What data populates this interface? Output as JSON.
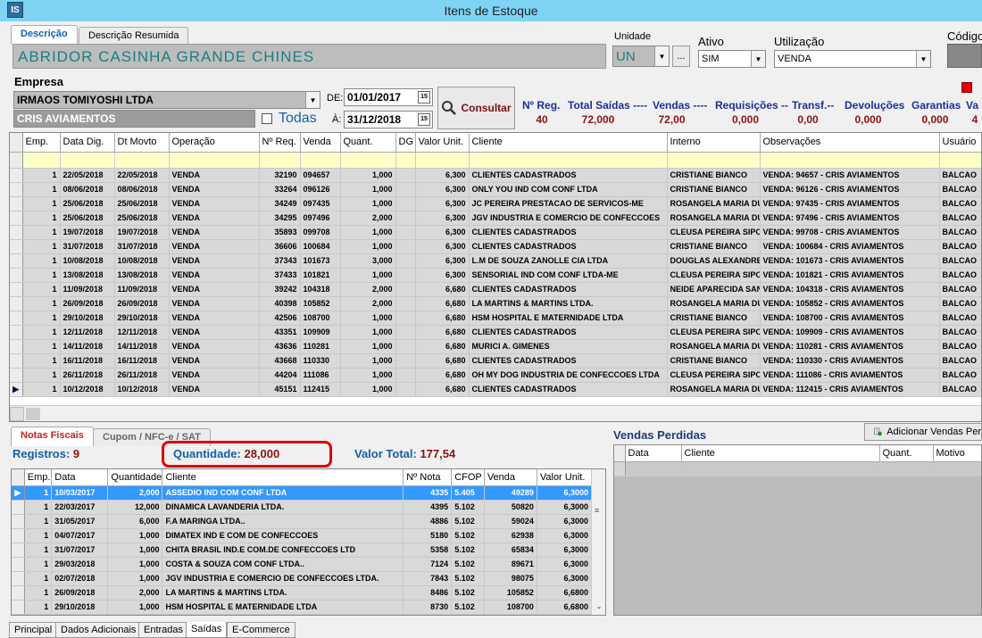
{
  "window": {
    "title": "Itens de Estoque",
    "icon_text": "IS"
  },
  "desc_tabs": [
    "Descrição",
    "Descrição Resumida"
  ],
  "description": "ABRIDOR CASINHA GRANDE CHINES",
  "unidade": {
    "label": "Unidade",
    "value": "UN",
    "btn": "..."
  },
  "ativo": {
    "label": "Ativo",
    "value": "SIM"
  },
  "utilizacao": {
    "label": "Utilização",
    "value": "VENDA"
  },
  "codigo": {
    "label": "Código"
  },
  "empresa": {
    "label": "Empresa",
    "value": "IRMAOS TOMIYOSHI LTDA",
    "client": "CRIS AVIAMENTOS",
    "todas": "Todas"
  },
  "dates": {
    "de_label": "DE:",
    "de": "01/01/2017",
    "a_label": "À:",
    "a": "31/12/2018",
    "cal": "15"
  },
  "consultar": "Consultar",
  "stats": {
    "headers": [
      "Nº Reg.",
      "Total Saídas ----",
      "Vendas ----",
      "Requisições --",
      "Transf.--",
      "Devoluções",
      "Garantias",
      "Va"
    ],
    "values": [
      "40",
      "72,000",
      "72,00",
      "0,000",
      "0,00",
      "0,000",
      "0,000",
      "4"
    ]
  },
  "main_grid": {
    "columns": [
      "Emp.",
      "Data Dig.",
      "Dt Movto",
      "Operação",
      "Nº Req.",
      "Venda",
      "Quant.",
      "DG",
      "Valor Unit.",
      "Cliente",
      "Interno",
      "Observações",
      "Usuário"
    ],
    "rows": [
      [
        "1",
        "22/05/2018",
        "22/05/2018",
        "VENDA",
        "32190",
        "094657",
        "1,000",
        "",
        "6,300",
        "CLIENTES CADASTRADOS",
        "CRISTIANE BIANCO",
        "VENDA: 94657 - CRIS AVIAMENTOS",
        "BALCAO"
      ],
      [
        "1",
        "08/06/2018",
        "08/06/2018",
        "VENDA",
        "33264",
        "096126",
        "1,000",
        "",
        "6,300",
        "ONLY YOU IND COM CONF LTDA",
        "CRISTIANE BIANCO",
        "VENDA: 96126 - CRIS AVIAMENTOS",
        "BALCAO"
      ],
      [
        "1",
        "25/06/2018",
        "25/06/2018",
        "VENDA",
        "34249",
        "097435",
        "1,000",
        "",
        "6,300",
        "JC PEREIRA PRESTACAO DE SERVICOS-ME",
        "ROSANGELA MARIA DU",
        "VENDA: 97435 - CRIS AVIAMENTOS",
        "BALCAO"
      ],
      [
        "1",
        "25/06/2018",
        "25/06/2018",
        "VENDA",
        "34295",
        "097496",
        "2,000",
        "",
        "6,300",
        "JGV INDUSTRIA E COMERCIO DE CONFECCOES",
        "ROSANGELA MARIA DU",
        "VENDA: 97496 - CRIS AVIAMENTOS",
        "BALCAO"
      ],
      [
        "1",
        "19/07/2018",
        "19/07/2018",
        "VENDA",
        "35893",
        "099708",
        "1,000",
        "",
        "6,300",
        "CLIENTES CADASTRADOS",
        "CLEUSA PEREIRA SIPO",
        "VENDA: 99708 - CRIS AVIAMENTOS",
        "BALCAO"
      ],
      [
        "1",
        "31/07/2018",
        "31/07/2018",
        "VENDA",
        "36606",
        "100684",
        "1,000",
        "",
        "6,300",
        "CLIENTES CADASTRADOS",
        "CRISTIANE BIANCO",
        "VENDA: 100684 - CRIS AVIAMENTOS",
        "BALCAO"
      ],
      [
        "1",
        "10/08/2018",
        "10/08/2018",
        "VENDA",
        "37343",
        "101673",
        "3,000",
        "",
        "6,300",
        "L.M DE SOUZA ZANOLLE CIA LTDA",
        "DOUGLAS ALEXANDRE",
        "VENDA: 101673 - CRIS AVIAMENTOS",
        "BALCAO"
      ],
      [
        "1",
        "13/08/2018",
        "13/08/2018",
        "VENDA",
        "37433",
        "101821",
        "1,000",
        "",
        "6,300",
        "SENSORIAL IND COM CONF LTDA-ME",
        "CLEUSA PEREIRA SIPO",
        "VENDA: 101821 - CRIS AVIAMENTOS",
        "BALCAO"
      ],
      [
        "1",
        "11/09/2018",
        "11/09/2018",
        "VENDA",
        "39242",
        "104318",
        "2,000",
        "",
        "6,680",
        "CLIENTES CADASTRADOS",
        "NEIDE APARECIDA SAN",
        "VENDA: 104318 - CRIS AVIAMENTOS",
        "BALCAO"
      ],
      [
        "1",
        "26/09/2018",
        "26/09/2018",
        "VENDA",
        "40398",
        "105852",
        "2,000",
        "",
        "6,680",
        "LA MARTINS & MARTINS LTDA.",
        "ROSANGELA MARIA DU",
        "VENDA: 105852 - CRIS AVIAMENTOS",
        "BALCAO"
      ],
      [
        "1",
        "29/10/2018",
        "29/10/2018",
        "VENDA",
        "42506",
        "108700",
        "1,000",
        "",
        "6,680",
        "HSM HOSPITAL E MATERNIDADE LTDA",
        "CRISTIANE BIANCO",
        "VENDA: 108700 - CRIS AVIAMENTOS",
        "BALCAO"
      ],
      [
        "1",
        "12/11/2018",
        "12/11/2018",
        "VENDA",
        "43351",
        "109909",
        "1,000",
        "",
        "6,680",
        "CLIENTES CADASTRADOS",
        "CLEUSA PEREIRA SIPO",
        "VENDA: 109909 - CRIS AVIAMENTOS",
        "BALCAO"
      ],
      [
        "1",
        "14/11/2018",
        "14/11/2018",
        "VENDA",
        "43636",
        "110281",
        "1,000",
        "",
        "6,680",
        "MURICI A. GIMENES",
        "ROSANGELA MARIA DU",
        "VENDA: 110281 - CRIS AVIAMENTOS",
        "BALCAO"
      ],
      [
        "1",
        "16/11/2018",
        "16/11/2018",
        "VENDA",
        "43668",
        "110330",
        "1,000",
        "",
        "6,680",
        "CLIENTES CADASTRADOS",
        "CRISTIANE BIANCO",
        "VENDA: 110330 - CRIS AVIAMENTOS",
        "BALCAO"
      ],
      [
        "1",
        "26/11/2018",
        "26/11/2018",
        "VENDA",
        "44204",
        "111086",
        "1,000",
        "",
        "6,680",
        "OH MY DOG INDUSTRIA DE CONFECCOES LTDA",
        "CLEUSA PEREIRA SIPO",
        "VENDA: 111086 - CRIS AVIAMENTOS",
        "BALCAO"
      ],
      [
        "1",
        "10/12/2018",
        "10/12/2018",
        "VENDA",
        "45151",
        "112415",
        "1,000",
        "",
        "6,680",
        "CLIENTES CADASTRADOS",
        "ROSANGELA MARIA DU",
        "VENDA: 112415 - CRIS AVIAMENTOS",
        "BALCAO"
      ]
    ]
  },
  "lower_tabs": [
    "Notas Fiscais",
    "Cupom / NFC-e / SAT"
  ],
  "summary": {
    "registros_label": "Registros:",
    "registros": "9",
    "quantidade_label": "Quantidade:",
    "quantidade": "28,000",
    "valor_label": "Valor Total:",
    "valor": "177,54"
  },
  "nf_grid": {
    "columns": [
      "Emp.",
      "Data",
      "Quantidade",
      "Cliente",
      "Nº Nota",
      "CFOP",
      "Venda",
      "Valor Unit."
    ],
    "rows": [
      [
        "1",
        "10/03/2017",
        "2,000",
        "ASSEDIO IND COM CONF LTDA",
        "4335",
        "5.405",
        "49289",
        "6,3000"
      ],
      [
        "1",
        "22/03/2017",
        "12,000",
        "DINAMICA LAVANDERIA LTDA.",
        "4395",
        "5.102",
        "50820",
        "6,3000"
      ],
      [
        "1",
        "31/05/2017",
        "6,000",
        "F.A MARINGA LTDA..",
        "4886",
        "5.102",
        "59024",
        "6,3000"
      ],
      [
        "1",
        "04/07/2017",
        "1,000",
        "DIMATEX IND E COM DE CONFECCOES",
        "5180",
        "5.102",
        "62938",
        "6,3000"
      ],
      [
        "1",
        "31/07/2017",
        "1,000",
        "CHITA BRASIL IND.E COM.DE CONFECCOES LTD",
        "5358",
        "5.102",
        "65834",
        "6,3000"
      ],
      [
        "1",
        "29/03/2018",
        "1,000",
        "COSTA & SOUZA COM CONF LTDA..",
        "7124",
        "5.102",
        "89671",
        "6,3000"
      ],
      [
        "1",
        "02/07/2018",
        "1,000",
        "JGV INDUSTRIA E COMERCIO DE CONFECCOES LTDA.",
        "7843",
        "5.102",
        "98075",
        "6,3000"
      ],
      [
        "1",
        "26/09/2018",
        "2,000",
        "LA MARTINS & MARTINS LTDA.",
        "8486",
        "5.102",
        "105852",
        "6,6800"
      ],
      [
        "1",
        "29/10/2018",
        "1,000",
        "HSM HOSPITAL E MATERNIDADE LTDA",
        "8730",
        "5.102",
        "108700",
        "6,6800"
      ]
    ]
  },
  "vendas_perdidas": {
    "title": "Vendas Perdidas",
    "add_btn": "Adicionar Vendas Per",
    "columns": [
      "Data",
      "Cliente",
      "Quant.",
      "Motivo"
    ]
  },
  "bottom_tabs": [
    "Principal",
    "Dados Adicionais",
    "Entradas",
    "Saídas",
    "E-Commerce"
  ],
  "colors": {
    "accent": "#1460aa",
    "title_bar": "#7fd4f4",
    "stat_header": "#1b2f9c",
    "stat_value": "#8a1414",
    "highlight_circle": "#e00000",
    "selected_row": "#3399ff",
    "filter_row": "#ffffc8"
  }
}
